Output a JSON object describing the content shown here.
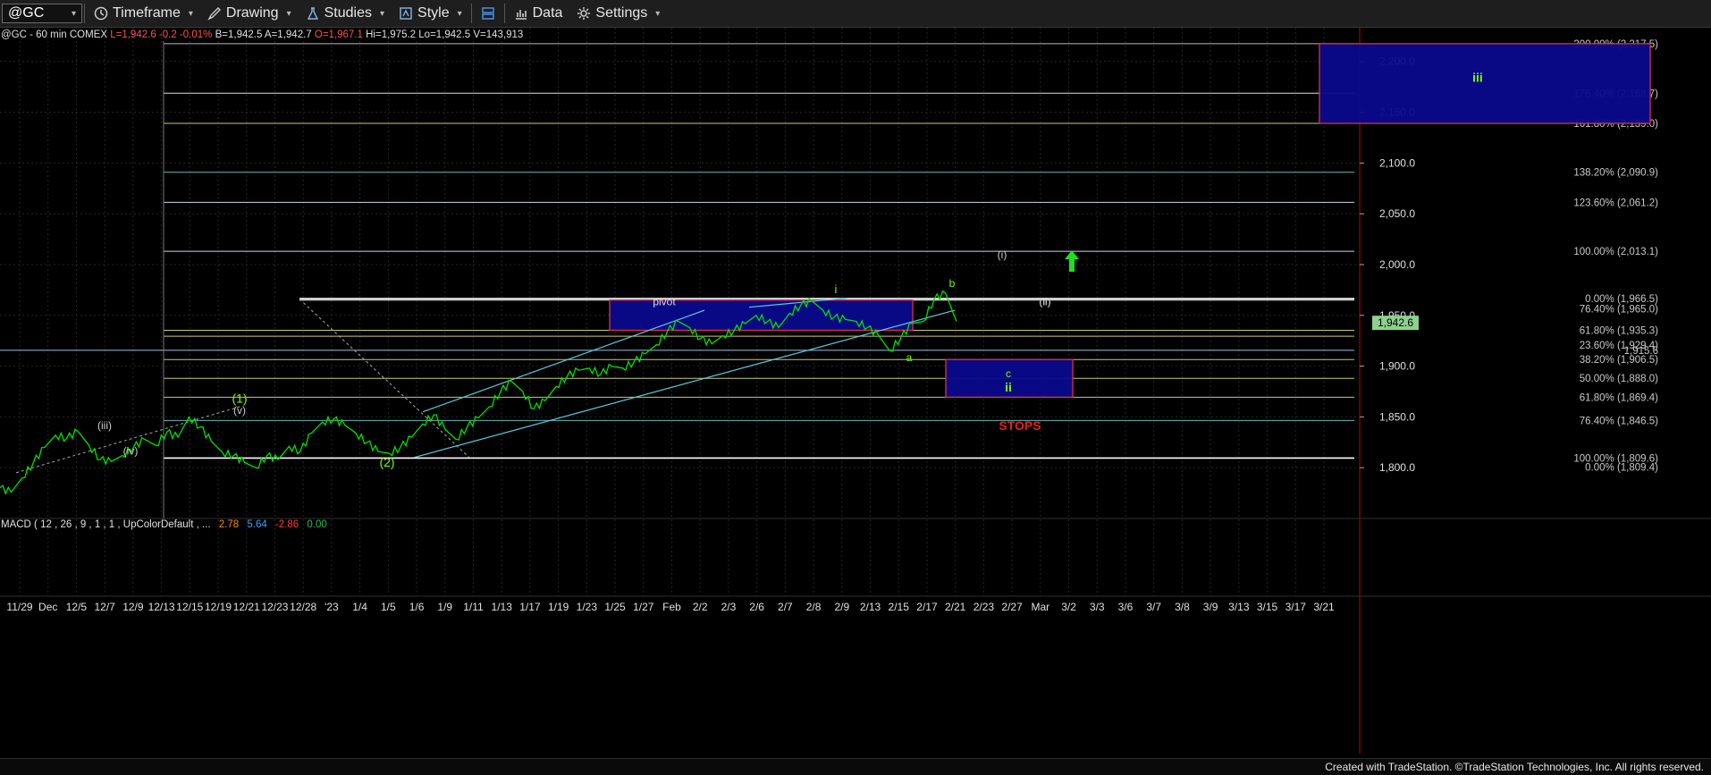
{
  "toolbar": {
    "symbol": "@GC",
    "timeframe": "Timeframe",
    "drawing": "Drawing",
    "studies": "Studies",
    "style": "Style",
    "data": "Data",
    "settings": "Settings"
  },
  "header": {
    "instrument": "@GC - 60 min  COMEX",
    "last": "L=1,942.6",
    "net": "-0.2",
    "pct": "-0.01%",
    "bid": "B=1,942.5",
    "ask": "A=1,942.7",
    "open": "O=1,967.1",
    "high": "Hi=1,975.2",
    "low": "Lo=1,942.5",
    "volume": "V=143,913"
  },
  "macd": {
    "label": "MACD ( 12 , 26 , 9 , 1 , 1 , UpColorDefault , ...",
    "v1": "2.78",
    "v2": "5.64",
    "v3": "-2.86",
    "v4": "0.00"
  },
  "footer": "Created with TradeStation. ©TradeStation Technologies, Inc. All rights reserved.",
  "colors": {
    "price": "#00e000",
    "fib_label": "#c8c8c8",
    "box_fill": "#0a0a8c",
    "box_border": "#e03040",
    "wave_label": "#7cfc00",
    "grid": "#262626"
  },
  "chart_data": {
    "type": "line",
    "symbol": "@GC",
    "interval": "60 min",
    "ylim": [
      1750,
      2220
    ],
    "y_ticks": [
      "2,200.0",
      "2,150.0",
      "2,100.0",
      "2,050.0",
      "2,000.0",
      "1,950.0",
      "1,900.0",
      "1,850.0",
      "1,800.0"
    ],
    "x_tick_labels": [
      "11/29",
      "Dec",
      "12/5",
      "12/7",
      "12/9",
      "12/13",
      "12/15",
      "12/19",
      "12/21",
      "12/23",
      "12/28",
      "'23",
      "1/4",
      "1/5",
      "1/6",
      "1/9",
      "1/11",
      "1/13",
      "1/17",
      "1/19",
      "1/23",
      "1/25",
      "1/27",
      "Feb",
      "2/2",
      "2/3",
      "2/6",
      "2/7",
      "2/8",
      "2/9",
      "2/13",
      "2/15",
      "2/17",
      "2/21",
      "2/23",
      "2/27",
      "Mar",
      "3/2",
      "3/3",
      "3/6",
      "3/7",
      "3/8",
      "3/9",
      "3/13",
      "3/15",
      "3/17",
      "3/21"
    ],
    "series": [
      {
        "type": "price",
        "values": [
          1780,
          1776,
          1790,
          1805,
          1820,
          1832,
          1829,
          1836,
          1822,
          1808,
          1806,
          1812,
          1820,
          1828,
          1822,
          1835,
          1830,
          1850,
          1840,
          1826,
          1815,
          1812,
          1805,
          1800,
          1812,
          1808,
          1821,
          1816,
          1834,
          1845,
          1848,
          1842,
          1834,
          1825,
          1816,
          1814,
          1820,
          1830,
          1843,
          1852,
          1838,
          1828,
          1840,
          1849,
          1860,
          1875,
          1885,
          1875,
          1858,
          1866,
          1880,
          1890,
          1896,
          1898,
          1892,
          1900,
          1898,
          1904,
          1912,
          1921,
          1934,
          1944,
          1938,
          1927,
          1922,
          1930,
          1935,
          1942,
          1950,
          1944,
          1938,
          1952,
          1960,
          1964,
          1955,
          1948,
          1946,
          1944,
          1938,
          1930,
          1915,
          1928,
          1942,
          1944,
          1966,
          1972,
          1944
        ]
      }
    ],
    "horizontal_levels": [
      {
        "label": "200.00% (2,217.5)",
        "value": 2217.5
      },
      {
        "label": "176.40% (2,168.7)",
        "value": 2168.7
      },
      {
        "label": "161.80% (2,139.0)",
        "value": 2139.0
      },
      {
        "label": "138.20% (2,090.9)",
        "value": 2090.9
      },
      {
        "label": "123.60% (2,061.2)",
        "value": 2061.2
      },
      {
        "label": "100.00% (2,013.1)",
        "value": 2013.1
      },
      {
        "label": "0.00% (1,966.5)",
        "value": 1966.5
      },
      {
        "label": "76.40% (1,965.0)",
        "value": 1965.0
      },
      {
        "label": "61.80% (1,935.3)",
        "value": 1935.3
      },
      {
        "label": "23.60% (1,929.4)",
        "value": 1929.4
      },
      {
        "label": "1,915.6",
        "value": 1915.6
      },
      {
        "label": "38.20% (1,906.5)",
        "value": 1906.5
      },
      {
        "label": "50.00% (1,888.0)",
        "value": 1888.0
      },
      {
        "label": "61.80% (1,869.4)",
        "value": 1869.4
      },
      {
        "label": "76.40% (1,846.5)",
        "value": 1846.5
      },
      {
        "label": "100.00% (1,809.6)",
        "value": 1809.6
      },
      {
        "label": "0.00% (1,809.4)",
        "value": 1809.4
      }
    ],
    "last_price": "1,942.6",
    "wave_labels": [
      "(1)",
      "(v)",
      "(iii)",
      "(iv)",
      "(ii)",
      "(2)",
      "pivot",
      "i",
      "a",
      "b",
      "(i)",
      "(ii)",
      "c",
      "ii",
      "iii",
      "STOPS"
    ],
    "target_boxes": [
      {
        "name": "iii",
        "low": 2139.0,
        "high": 2217.5
      },
      {
        "name": "ii",
        "low": 1869.4,
        "high": 1906.5
      },
      {
        "name": "pivot",
        "low": 1935.3,
        "high": 1965.0
      }
    ]
  }
}
